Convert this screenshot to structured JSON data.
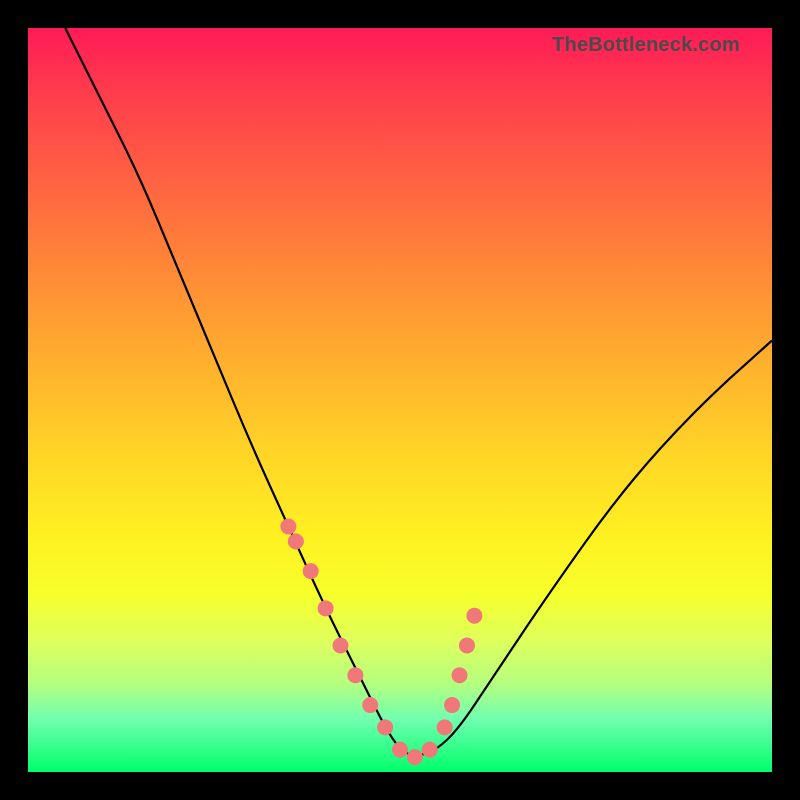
{
  "attribution": "TheBottleneck.com",
  "chart_data": {
    "type": "line",
    "title": "",
    "xlabel": "",
    "ylabel": "",
    "xlim": [
      0,
      100
    ],
    "ylim": [
      0,
      100
    ],
    "series": [
      {
        "name": "bottleneck-curve",
        "x": [
          5,
          10,
          15,
          20,
          25,
          30,
          35,
          40,
          45,
          48,
          50,
          52,
          55,
          58,
          62,
          70,
          80,
          90,
          100
        ],
        "values": [
          100,
          90,
          80,
          68,
          56,
          44,
          33,
          22,
          12,
          6,
          3,
          2,
          3,
          6,
          12,
          24,
          38,
          49,
          58
        ]
      }
    ],
    "markers": {
      "name": "highlight-dots",
      "color": "#f07878",
      "x": [
        35,
        36,
        38,
        40,
        42,
        44,
        46,
        48,
        50,
        52,
        54,
        56,
        57,
        58,
        59,
        60
      ],
      "values": [
        33,
        31,
        27,
        22,
        17,
        13,
        9,
        6,
        3,
        2,
        3,
        6,
        9,
        13,
        17,
        21
      ]
    },
    "gradient_stops": [
      {
        "pos": 0,
        "color": "#ff1a57"
      },
      {
        "pos": 50,
        "color": "#ffd726"
      },
      {
        "pos": 100,
        "color": "#00ff6a"
      }
    ]
  }
}
